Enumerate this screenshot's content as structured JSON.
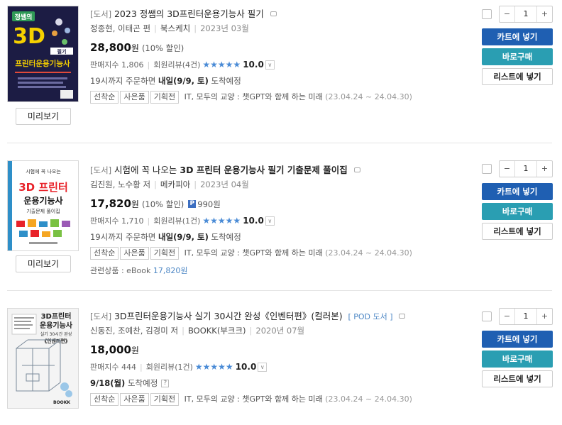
{
  "common": {
    "preview_label": "미리보기",
    "cart_label": "카트에 넣기",
    "buy_label": "바로구매",
    "list_label": "리스트에 넣기",
    "qty_minus": "−",
    "qty_plus": "+",
    "won": "원",
    "sales_label": "판매지수",
    "review_label": "회원리뷰",
    "stars": "★★★★★",
    "tags": [
      "선착순",
      "사은품",
      "기획전"
    ],
    "event_text": "IT, 모두의 교양 : 챗GPT와 함께 하는 미래",
    "event_dates": "(23.04.24 ~ 24.04.30)",
    "colors": {
      "cart": "#1f5fb2",
      "buy": "#2a9eb2",
      "stars": "#4a8bd6"
    }
  },
  "items": [
    {
      "category": "[도서]",
      "title": "2023 정쌤의 3D프린터운용기능사 필기",
      "authors": "정종현, 이태곤 편",
      "publisher": "북스케치",
      "date": "2023년 03월",
      "price": "28,800",
      "discount": "(10% 할인)",
      "sales_index": "1,806",
      "reviews": "(4건)",
      "score": "10.0",
      "shipping_prefix": "19시까지 주문하면",
      "shipping_bold": "내일(9/9, 토)",
      "shipping_suffix": "도착예정",
      "quantity": "1",
      "cover": {
        "top": "정쌤의",
        "big": "3D",
        "tag": "필기",
        "sub": "프린터운용기능사",
        "bg": "#1c1c44",
        "accent": "#f5d000"
      }
    },
    {
      "category": "[도서]",
      "title_pre": "시험에 꼭 나오는",
      "title_main": "3D 프린터 운용기능사 필기 기출문제 풀이집",
      "authors": "김진원, 노수황 저",
      "publisher": "메카피아",
      "date": "2023년 04월",
      "price": "17,820",
      "discount": "(10% 할인)",
      "points_badge": "P",
      "points": "990원",
      "sales_index": "1,710",
      "reviews": "(1건)",
      "score": "10.0",
      "shipping_prefix": "19시까지 주문하면",
      "shipping_bold": "내일(9/9, 토)",
      "shipping_suffix": "도착예정",
      "related_label": "관련상품 : eBook",
      "related_price": "17,820원",
      "quantity": "1",
      "cover": {
        "top": "시험에 꼭 나오는",
        "big": "3D 프린터",
        "sub": "운용기능사",
        "tag": "기출문제 풀이집"
      }
    },
    {
      "category": "[도서]",
      "title": "3D프린터운용기능사 실기 30시간 완성《인벤터편》(컬러본)",
      "pod": "[ POD 도서 ]",
      "authors": "신동진, 조예찬, 김경미 저",
      "publisher": "BOOKK(부크크)",
      "date": "2020년 07월",
      "price": "18,000",
      "sales_index": "444",
      "reviews": "(1건)",
      "score": "10.0",
      "shipping_bold": "9/18(월)",
      "shipping_suffix": "도착예정",
      "help": "?",
      "quantity": "1",
      "cover": {
        "big": "3D프린터",
        "sub": "운용기능사",
        "line": "실기 30시간 완성",
        "tag": "《인벤터편》",
        "brand": "BOOKK"
      }
    }
  ]
}
